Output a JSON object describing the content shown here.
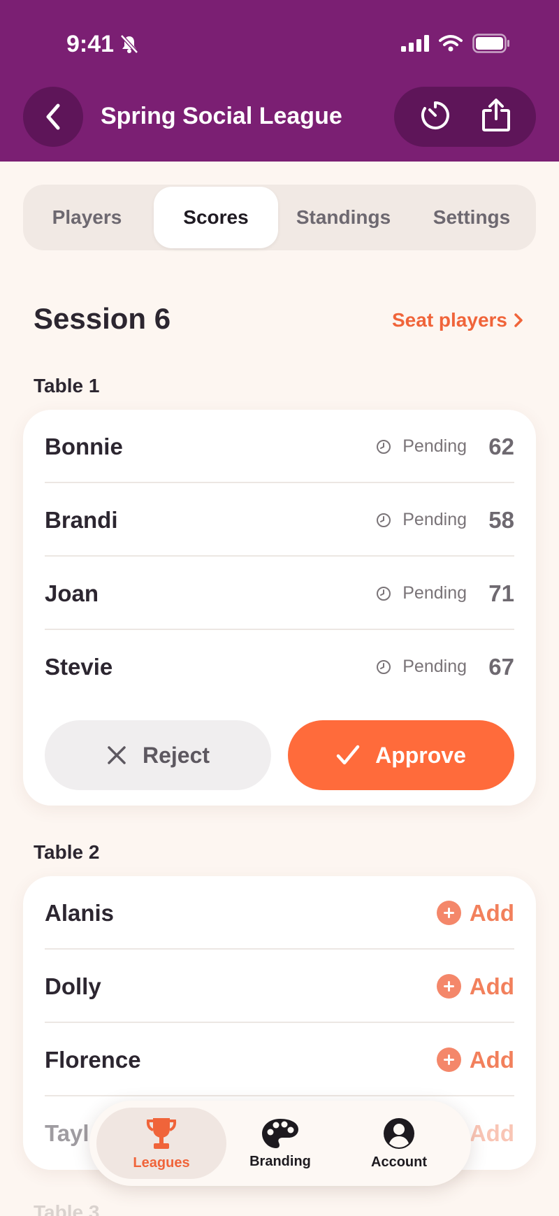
{
  "status_bar": {
    "time": "9:41"
  },
  "header": {
    "title": "Spring Social League"
  },
  "tabs": [
    {
      "label": "Players"
    },
    {
      "label": "Scores"
    },
    {
      "label": "Standings"
    },
    {
      "label": "Settings"
    }
  ],
  "active_tab": "Scores",
  "session": {
    "title": "Session 6",
    "seat_link": "Seat players"
  },
  "table1": {
    "label": "Table 1",
    "rows": [
      {
        "name": "Bonnie",
        "status": "Pending",
        "score": "62"
      },
      {
        "name": "Brandi",
        "status": "Pending",
        "score": "58"
      },
      {
        "name": "Joan",
        "status": "Pending",
        "score": "71"
      },
      {
        "name": "Stevie",
        "status": "Pending",
        "score": "67"
      }
    ],
    "reject_label": "Reject",
    "approve_label": "Approve"
  },
  "table2": {
    "label": "Table 2",
    "rows": [
      {
        "name": "Alanis",
        "action": "Add"
      },
      {
        "name": "Dolly",
        "action": "Add"
      },
      {
        "name": "Florence",
        "action": "Add"
      },
      {
        "name": "Tayl",
        "action": "Add"
      }
    ]
  },
  "table3": {
    "label": "Table 3"
  },
  "bottom_nav": [
    {
      "label": "Leagues",
      "icon": "trophy-icon"
    },
    {
      "label": "Branding",
      "icon": "palette-icon"
    },
    {
      "label": "Account",
      "icon": "account-icon"
    }
  ],
  "colors": {
    "header": "#7b1f73",
    "accent": "#ff6b3b",
    "background": "#fdf6f1"
  }
}
